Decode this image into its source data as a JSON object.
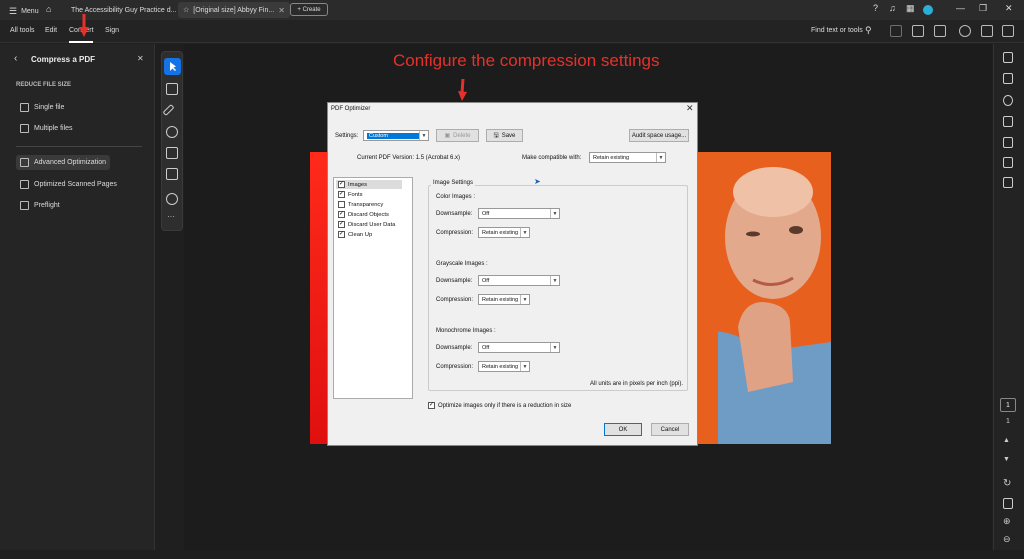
{
  "titlebar": {
    "menu_label": "Menu",
    "tabs": [
      {
        "label": "The Accessibility Guy Practice d..."
      },
      {
        "label": "[Original size] Abbyy Fin..."
      }
    ],
    "create_label": "+ Create"
  },
  "menubar": {
    "items": [
      "All tools",
      "Edit",
      "Convert",
      "Sign"
    ],
    "find_label": "Find text or tools"
  },
  "leftpanel": {
    "title": "Compress a PDF",
    "section": "REDUCE FILE SIZE",
    "items": [
      "Single file",
      "Multiple files",
      "Advanced Optimization",
      "Optimized Scanned Pages",
      "Preflight"
    ]
  },
  "annotation": "Configure the compression settings",
  "dialog": {
    "title": "PDF Optimizer",
    "settings_label": "Settings:",
    "settings_value": "Custom",
    "delete_label": "Delete",
    "save_label": "Save",
    "audit_label": "Audit space usage...",
    "version_text": "Current PDF Version: 1.5 (Acrobat 6.x)",
    "compat_label": "Make compatible with:",
    "compat_value": "Retain existing",
    "list": [
      {
        "label": "Images",
        "checked": true
      },
      {
        "label": "Fonts",
        "checked": true
      },
      {
        "label": "Transparency",
        "checked": false
      },
      {
        "label": "Discard Objects",
        "checked": true
      },
      {
        "label": "Discard User Data",
        "checked": true
      },
      {
        "label": "Clean Up",
        "checked": true
      }
    ],
    "image_settings": "Image Settings",
    "color_images": "Color Images :",
    "grayscale_images": "Grayscale Images :",
    "mono_images": "Monochrome Images :",
    "downsample_label": "Downsample:",
    "compression_label": "Compression:",
    "downsample_value": "Off",
    "compression_value": "Retain existing",
    "units_note": "All units are in pixels per inch (ppi).",
    "optimize_label": "Optimize images only if there is a reduction in size",
    "ok_label": "OK",
    "cancel_label": "Cancel"
  },
  "page_number": "1",
  "page_total": "1",
  "colors": {
    "accent": "#1473e6",
    "annotation": "#e8302a",
    "settings_highlight": "#0078d7"
  }
}
